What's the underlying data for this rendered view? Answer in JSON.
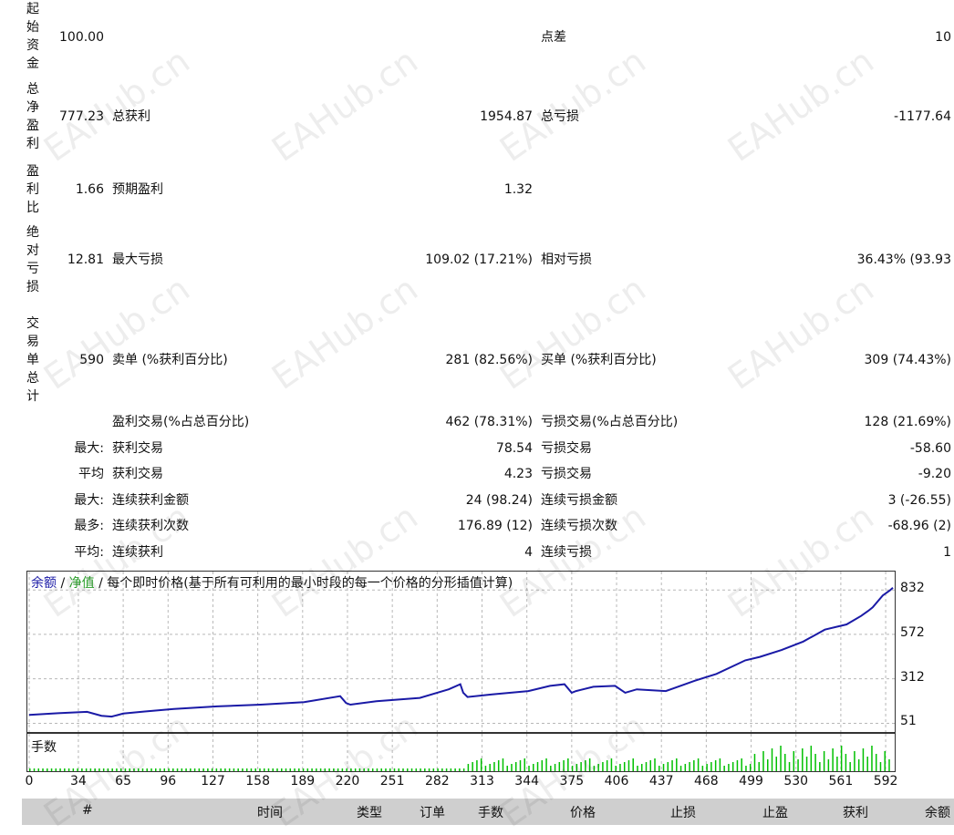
{
  "summary": {
    "initial_deposit_label": "起始资金",
    "initial_deposit": "100.00",
    "spread_label": "点差",
    "spread": "10",
    "net_profit_label": "总净盈利",
    "net_profit": "777.23",
    "gross_profit_label": "总获利",
    "gross_profit": "1954.87",
    "gross_loss_label": "总亏损",
    "gross_loss": "-1177.64",
    "profit_factor_label": "盈利比",
    "profit_factor": "1.66",
    "expected_payoff_label": "预期盈利",
    "expected_payoff": "1.32",
    "abs_drawdown_label": "绝对亏损",
    "abs_drawdown": "12.81",
    "max_drawdown_label": "最大亏损",
    "max_drawdown": "109.02 (17.21%)",
    "rel_drawdown_label": "相对亏损",
    "rel_drawdown": "36.43% (93.93",
    "total_trades_label": "交易单总计",
    "total_trades": "590",
    "short_label": "卖单 (%获利百分比)",
    "short_value": "281 (82.56%)",
    "long_label": "买单 (%获利百分比)",
    "long_value": "309 (74.43%)",
    "profit_trades_label": "盈利交易(%占总百分比)",
    "profit_trades": "462 (78.31%)",
    "loss_trades_label": "亏损交易(%占总百分比)",
    "loss_trades": "128 (21.69%)"
  },
  "stats_rows": [
    {
      "prefix": "最大:",
      "label1": "获利交易",
      "value1": "78.54",
      "label2": "亏损交易",
      "value2": "-58.60"
    },
    {
      "prefix": "平均",
      "label1": "获利交易",
      "value1": "4.23",
      "label2": "亏损交易",
      "value2": "-9.20"
    },
    {
      "prefix": "最大:",
      "label1": "连续获利金额",
      "value1": "24 (98.24)",
      "label2": "连续亏损金额",
      "value2": "3 (-26.55)"
    },
    {
      "prefix": "最多:",
      "label1": "连续获利次数",
      "value1": "176.89 (12)",
      "label2": "连续亏损次数",
      "value2": "-68.96 (2)"
    },
    {
      "prefix": "平均:",
      "label1": "连续获利",
      "value1": "4",
      "label2": "连续亏损",
      "value2": "1"
    }
  ],
  "chart_legend": {
    "balance": "余额",
    "sep1": " / ",
    "equity": "净值",
    "sep2": " / ",
    "description": "每个即时价格(基于所有可利用的最小时段的每一个价格的分形插值计算)"
  },
  "volume_label": "手数",
  "watermark_text": "EAHub.cn",
  "colors": {
    "balance": "#1a1aa6",
    "equity": "#2aa02a",
    "volume": "#00c000",
    "grid": "#b8b8b8",
    "header_bg": "#cfcfcf"
  },
  "chart_data": {
    "type": "line",
    "title": "",
    "x_ticks": [
      0,
      34,
      65,
      96,
      127,
      158,
      189,
      220,
      251,
      282,
      313,
      344,
      375,
      406,
      437,
      468,
      499,
      530,
      561,
      592
    ],
    "y_ticks": [
      51,
      312,
      572,
      832
    ],
    "xlim": [
      0,
      597
    ],
    "ylim": [
      0,
      940
    ],
    "series": [
      {
        "name": "余额",
        "x": [
          0,
          20,
          40,
          50,
          57,
          65,
          80,
          100,
          130,
          160,
          190,
          215,
          219,
          222,
          240,
          270,
          290,
          298,
          300,
          303,
          320,
          345,
          360,
          370,
          375,
          378,
          390,
          405,
          412,
          420,
          440,
          445,
          460,
          475,
          490,
          495,
          505,
          520,
          535,
          550,
          565,
          575,
          580,
          583,
          590,
          595,
          597
        ],
        "y": [
          100,
          110,
          118,
          95,
          90,
          108,
          120,
          135,
          150,
          160,
          175,
          210,
          170,
          160,
          180,
          200,
          250,
          280,
          230,
          205,
          220,
          240,
          270,
          280,
          230,
          240,
          265,
          270,
          230,
          250,
          240,
          255,
          300,
          340,
          400,
          420,
          440,
          480,
          530,
          600,
          630,
          680,
          710,
          730,
          800,
          830,
          845
        ]
      }
    ],
    "volume_bars_note_series": {
      "name": "手数"
    }
  },
  "table_header": [
    "#",
    "时间",
    "类型",
    "订单",
    "手数",
    "价格",
    "止损",
    "止盈",
    "获利",
    "余额"
  ]
}
